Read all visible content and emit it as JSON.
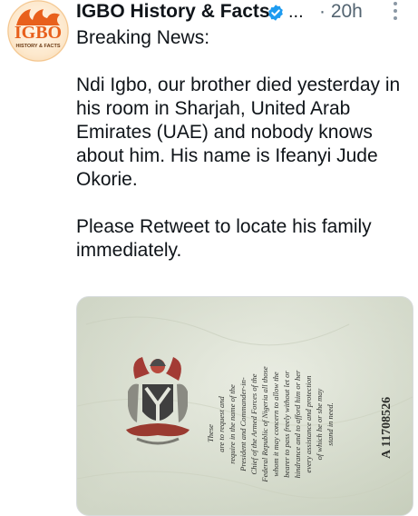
{
  "account": {
    "avatar_text": "IGBO",
    "avatar_subtext": "HISTORY & FACTS",
    "name": "IGBO History & Facts",
    "verified": true,
    "handle_truncation": "...",
    "timestamp": "· 20h"
  },
  "tweet": {
    "paragraphs": [
      "Breaking News:",
      "Ndi Igbo, our brother died yesterday in his room in Sharjah, United Arab Emirates (UAE) and nobody knows about him. His name is Ifeanyi Jude Okorie.",
      "Please Retweet to locate his family immediately."
    ]
  },
  "media": {
    "serial_number": "A 11708526",
    "passport_text": [
      "These",
      "are to request and",
      "require in the name of the",
      "President and Commander-in-",
      "Chief of the Armed Forces of the",
      "Federal Republic of Nigeria all those",
      "whom it may concern to allow the",
      "bearer to pass freely without let or",
      "hindrance and to afford him or her",
      "every assistance and protection",
      "of which he or she may",
      "stand in need."
    ]
  },
  "colors": {
    "text": "#0f1419",
    "muted": "#536471",
    "verified": "#1d9bf0",
    "avatar_accent": "#e8601c"
  }
}
